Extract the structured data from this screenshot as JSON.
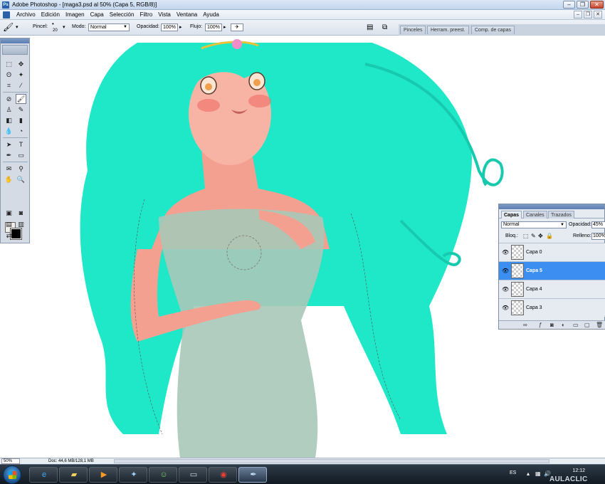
{
  "window": {
    "title": "Adobe Photoshop - [maga3.psd al 50% (Capa 5, RGB/8)]"
  },
  "menubar": {
    "items": [
      "Archivo",
      "Edición",
      "Imagen",
      "Capa",
      "Selección",
      "Filtro",
      "Vista",
      "Ventana",
      "Ayuda"
    ]
  },
  "options": {
    "brush_label": "Pincel:",
    "brush_size": "20",
    "mode_label": "Modo:",
    "mode_value": "Normal",
    "opacity_label": "Opacidad:",
    "opacity_value": "100%",
    "flow_label": "Flujo:",
    "flow_value": "100%"
  },
  "palette_well": {
    "tabs": [
      "Pinceles",
      "Herram. preest.",
      "Comp. de capas"
    ]
  },
  "layers_panel": {
    "tabs": [
      "Capas",
      "Canales",
      "Trazados"
    ],
    "blend_mode": "Normal",
    "opacity_label": "Opacidad:",
    "opacity_value": "45%",
    "lock_label": "Bloq.:",
    "fill_label": "Relleno:",
    "fill_value": "100%",
    "layers": [
      {
        "name": "Capa 0",
        "selected": false
      },
      {
        "name": "Capa 5",
        "selected": true
      },
      {
        "name": "Capa 4",
        "selected": false
      },
      {
        "name": "Capa 3",
        "selected": false
      }
    ]
  },
  "status": {
    "zoom": "50%",
    "doc": "Doc: 44,6 MB/128,1 MB"
  },
  "tray": {
    "lang": "ES",
    "time": "12:12",
    "date": "",
    "watermark": "AULACLIC"
  },
  "colors": {
    "hair": "#1ee8c8",
    "skin": "#f4a090",
    "dress": "#a8c8b8",
    "selection": "#3c8ff0"
  }
}
